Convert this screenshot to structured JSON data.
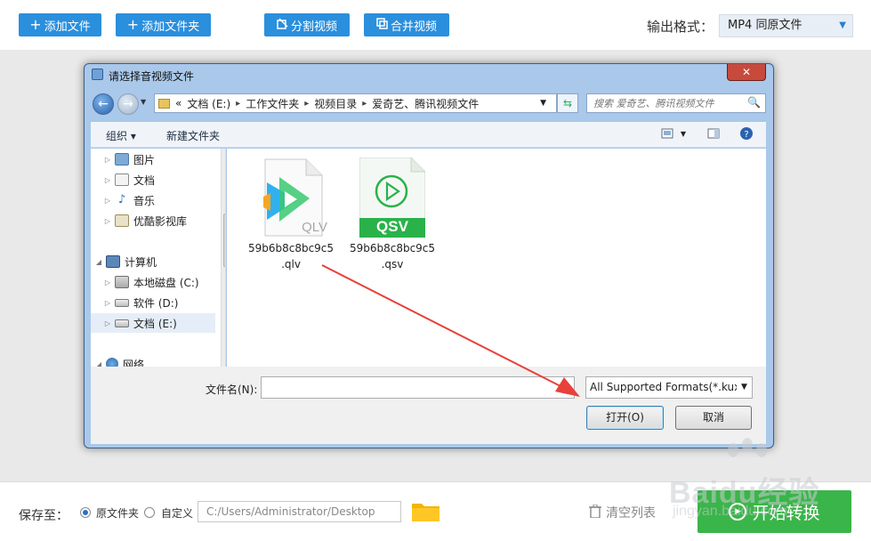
{
  "toolbar": {
    "add_file": "添加文件",
    "add_folder": "添加文件夹",
    "split_video": "分割视频",
    "merge_video": "合并视频",
    "output_format_label": "输出格式：",
    "output_format_value": "MP4  同原文件"
  },
  "dialog": {
    "title": "请选择音视频文件",
    "close": "✕",
    "breadcrumb": [
      "«",
      "文档 (E:)",
      "工作文件夹",
      "视频目录",
      "爱奇艺、腾讯视频文件"
    ],
    "search_placeholder": "搜索 爱奇艺、腾讯视频文件",
    "organize": "组织 ▾",
    "new_folder": "新建文件夹",
    "nav": [
      {
        "label": "图片"
      },
      {
        "label": "文档"
      },
      {
        "label": "音乐"
      },
      {
        "label": "优酷影视库"
      },
      {
        "label": "计算机"
      },
      {
        "label": "本地磁盘 (C:)"
      },
      {
        "label": "软件 (D:)"
      },
      {
        "label": "文档 (E:)"
      },
      {
        "label": "网络"
      }
    ],
    "files": [
      {
        "name": "59b6b8c8bc9c5\n.qlv",
        "badge": "QLV"
      },
      {
        "name": "59b6b8c8bc9c5\n.qsv",
        "badge": "QSV"
      }
    ],
    "filename_label": "文件名(N):",
    "filename_value": "",
    "filter": "All Supported Formats(*.kux",
    "open": "打开(O)",
    "cancel": "取消"
  },
  "footer": {
    "save_to": "保存至：",
    "option_original": "原文件夹",
    "option_custom": "自定义",
    "path": "C:/Users/Administrator/Desktop",
    "clear_list": "清空列表",
    "start": "开始转换"
  },
  "colors": {
    "toolbar_button": "#2a8fdd",
    "start_button": "#3ab54a",
    "arrow": "#e8403a"
  },
  "watermark": {
    "brand": "Baidu经验",
    "sub": "jingyan.baidu.com"
  }
}
